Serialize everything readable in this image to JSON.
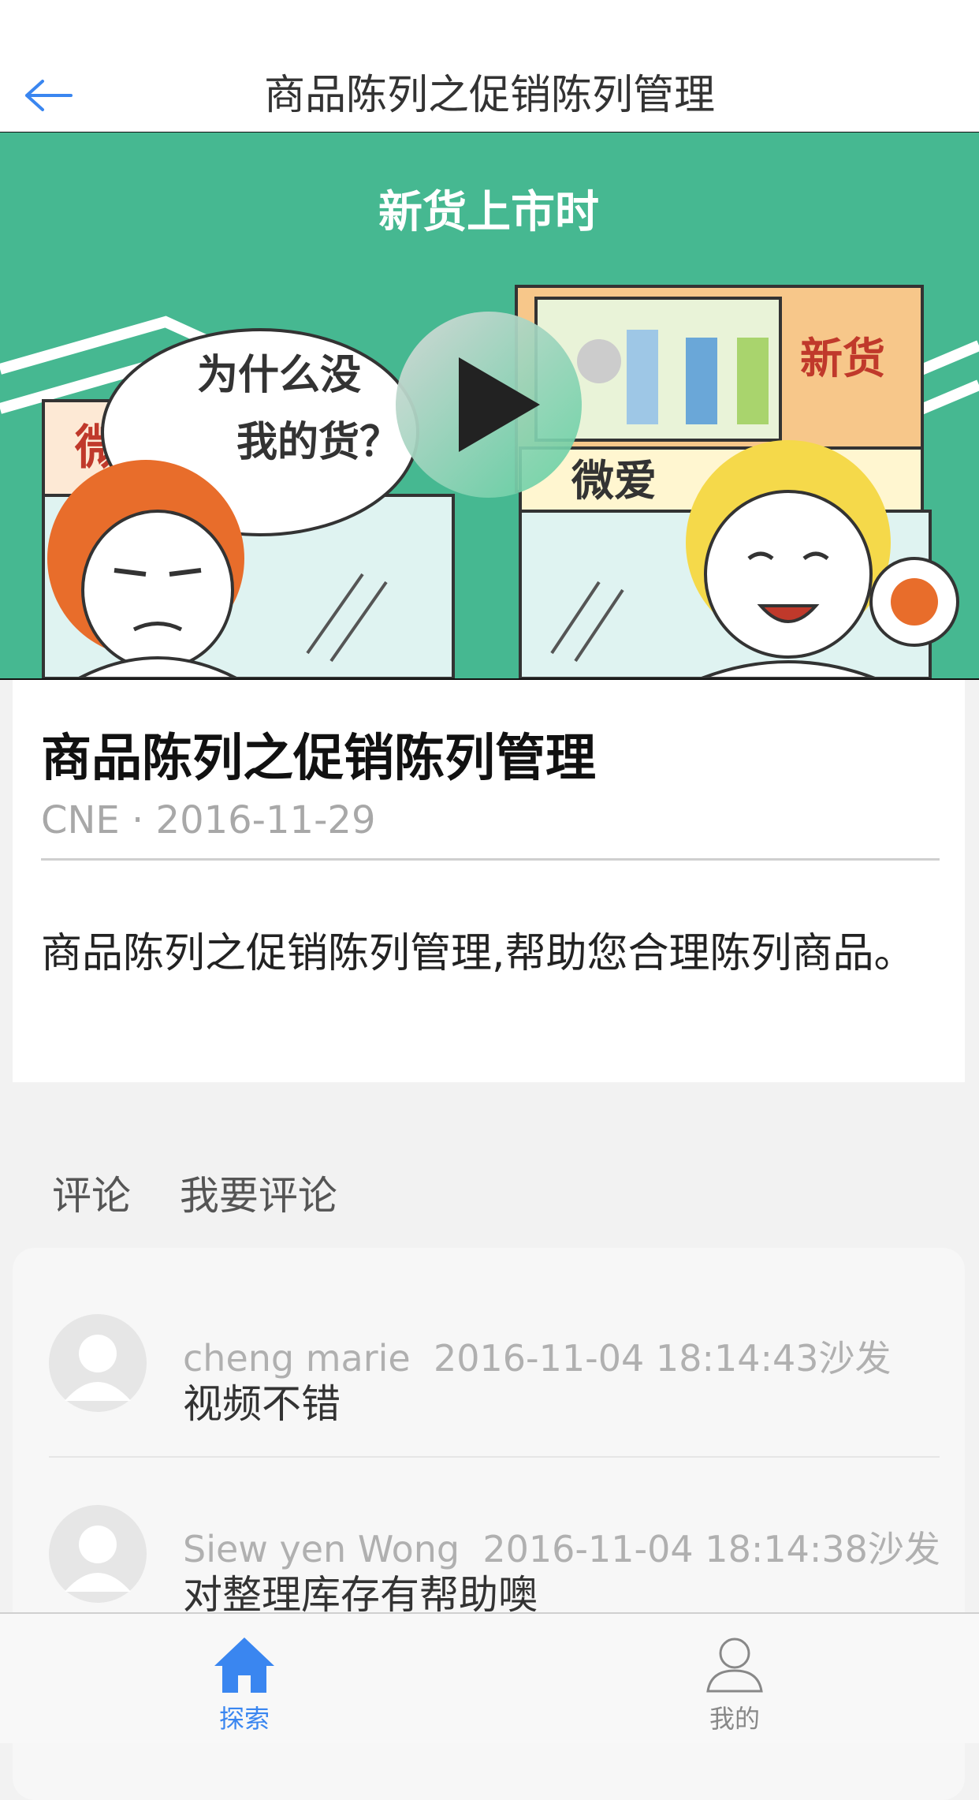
{
  "nav": {
    "title": "商品陈列之促销陈列管理",
    "back_icon": "back-arrow-icon",
    "accent_color": "#3a86f0"
  },
  "video": {
    "headline": "新货上市时",
    "bubble_text_line1": "为什么没",
    "bubble_text_line2": "我的货？",
    "sign_left": "微爱",
    "sign_right": "新货",
    "sign_right_shop": "微爱",
    "play_icon": "play-icon"
  },
  "article": {
    "title": "商品陈列之促销陈列管理",
    "meta": "CNE · 2016-11-29",
    "description": "商品陈列之促销陈列管理,帮助您合理陈列商品。"
  },
  "comments": {
    "tab_label": "评论",
    "write_label": "我要评论",
    "items": [
      {
        "user": "cheng marie",
        "time": "2016-11-04 18:14:43",
        "badge": "沙发",
        "text": "视频不错"
      },
      {
        "user": "Siew yen Wong",
        "time": "2016-11-04 18:14:38",
        "badge": "沙发",
        "text": "对整理库存有帮助噢"
      }
    ]
  },
  "tabbar": {
    "items": [
      {
        "label": "探索",
        "icon": "home-icon",
        "active": true,
        "color": "#3a86f0"
      },
      {
        "label": "我的",
        "icon": "person-icon",
        "active": false,
        "color": "#888888"
      }
    ]
  }
}
